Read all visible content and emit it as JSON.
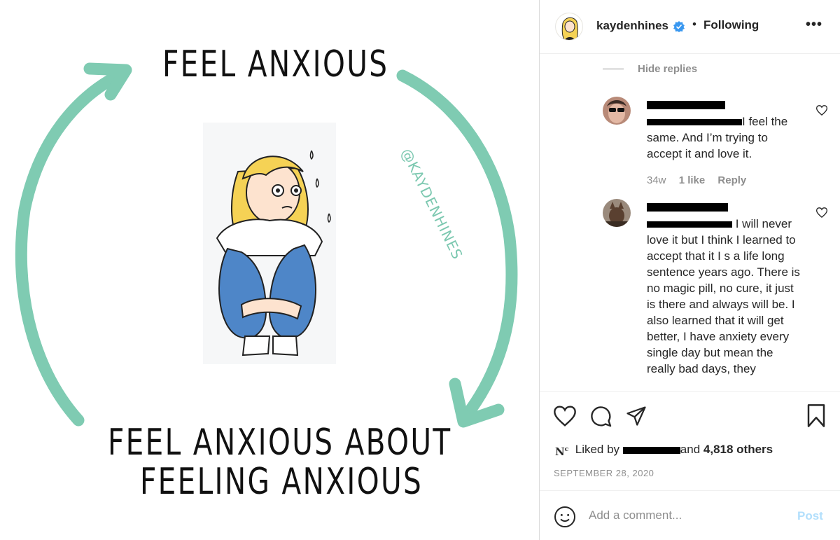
{
  "media": {
    "top_text": "FEEL ANXIOUS",
    "bottom_text_line1": "FEEL ANXIOUS ABOUT",
    "bottom_text_line2": "FEELING ANXIOUS",
    "watermark": "@KAYDENHINES",
    "arrow_color": "#7fcbb2"
  },
  "header": {
    "username": "kaydenhines",
    "separator": "•",
    "follow_status": "Following",
    "more_label": "•••",
    "verified_color": "#3897f0"
  },
  "comments": {
    "hide_replies_label": "Hide replies",
    "items": [
      {
        "text_after_mention": "I feel the same. And I’m trying to accept it and love it.",
        "time": "34w",
        "likes": "1 like",
        "reply_label": "Reply"
      },
      {
        "text_after_mention": "I will never love it but I think I learned to accept that it I s a life long sentence years ago. There is no magic pill, no cure, it just is there and always will be. I also learned that it will get better, I have anxiety every single day but mean the really bad days, they"
      }
    ]
  },
  "actions": {
    "liked_prefix": "Liked by",
    "liked_suffix_and": "and",
    "liked_others": "4,818 others",
    "date": "SEPTEMBER 28, 2020"
  },
  "composer": {
    "placeholder": "Add a comment...",
    "post_label": "Post"
  }
}
